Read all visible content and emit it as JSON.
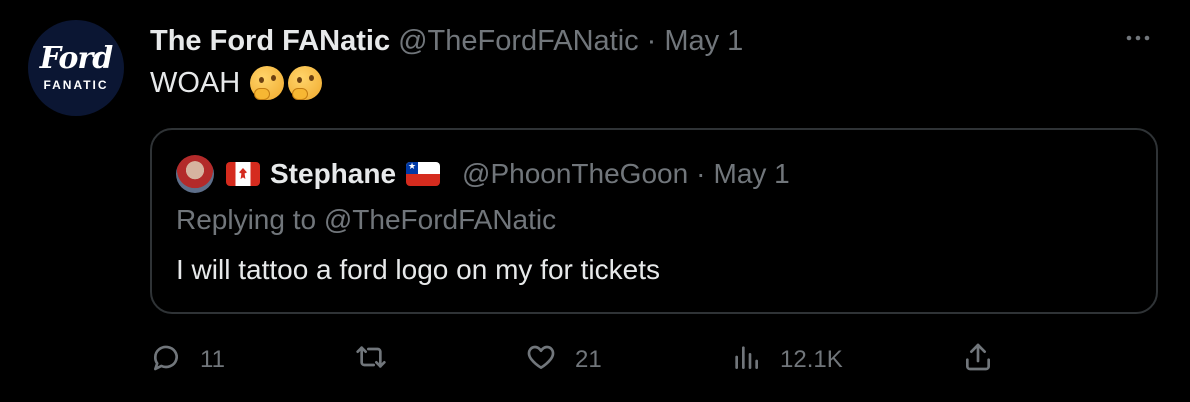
{
  "tweet": {
    "avatar": {
      "icon": "ford-fanatic-logo",
      "script_text": "Ford",
      "sub_text": "FANATIC",
      "bg_color": "#0b1633"
    },
    "author_name": "The Ford FANatic",
    "handle": "@TheFordFANatic",
    "separator": "·",
    "date": "May 1",
    "more_icon": "more-horizontal-icon",
    "text": "WOAH",
    "emojis": [
      "thinking-face-emoji",
      "thinking-face-emoji"
    ]
  },
  "quoted_tweet": {
    "avatar_icon": "user-avatar",
    "flag_before_name": "canada-flag",
    "author_name": "Stephane",
    "flag_after_name": "chile-flag",
    "handle": "@PhoonTheGoon",
    "separator": "·",
    "date": "May 1",
    "replying_to": "Replying to @TheFordFANatic",
    "text": "I will tattoo a ford logo on my for tickets"
  },
  "actions": {
    "reply": {
      "icon": "reply-icon",
      "count": "11"
    },
    "retweet": {
      "icon": "retweet-icon",
      "count": ""
    },
    "like": {
      "icon": "like-icon",
      "count": "21"
    },
    "views": {
      "icon": "views-icon",
      "count": "12.1K"
    },
    "share": {
      "icon": "share-icon",
      "count": ""
    }
  },
  "colors": {
    "background": "#000000",
    "primary_text": "#e7e9ea",
    "secondary_text": "#71767b",
    "border": "#2f3336"
  }
}
